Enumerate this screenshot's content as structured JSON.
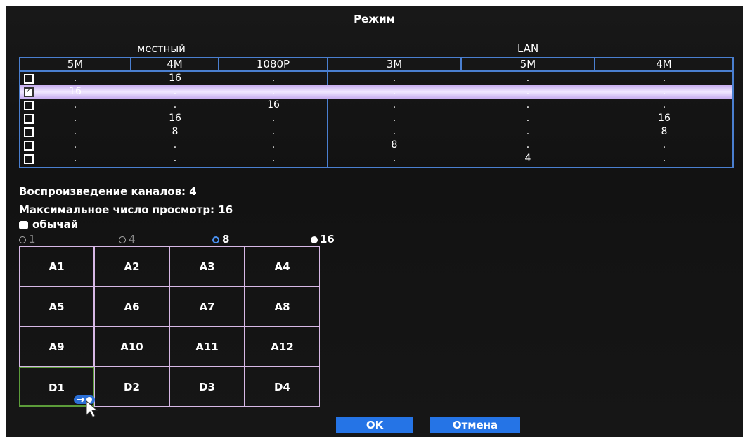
{
  "title": "Режим",
  "groups": {
    "local": "местный",
    "lan": "LAN"
  },
  "columns": [
    "5M",
    "4M",
    "1080P",
    "3M",
    "5M",
    "4M"
  ],
  "rows": [
    {
      "checked": false,
      "cells": [
        ".",
        "16",
        ".",
        ".",
        ".",
        "."
      ]
    },
    {
      "checked": true,
      "cells": [
        "16",
        ".",
        ".",
        ".",
        ".",
        "."
      ]
    },
    {
      "checked": false,
      "cells": [
        ".",
        ".",
        "16",
        ".",
        ".",
        "."
      ]
    },
    {
      "checked": false,
      "cells": [
        ".",
        "16",
        ".",
        ".",
        ".",
        "16"
      ]
    },
    {
      "checked": false,
      "cells": [
        ".",
        "8",
        ".",
        ".",
        ".",
        "8"
      ]
    },
    {
      "checked": false,
      "cells": [
        ".",
        ".",
        ".",
        "8",
        ".",
        "."
      ]
    },
    {
      "checked": false,
      "cells": [
        ".",
        ".",
        ".",
        ".",
        "4",
        "."
      ]
    }
  ],
  "info": {
    "playback_channels": "Воспроизведение каналов: 4",
    "max_view": "Максимальное число просмотр: 16"
  },
  "normal_label": "обычай",
  "split_options": [
    {
      "label": "1",
      "selected": false
    },
    {
      "label": "4",
      "selected": false
    },
    {
      "label": "8",
      "selected": false
    },
    {
      "label": "16",
      "selected": true
    }
  ],
  "channel_grid": [
    [
      "A1",
      "A2",
      "A3",
      "A4"
    ],
    [
      "A5",
      "A6",
      "A7",
      "A8"
    ],
    [
      "A9",
      "A10",
      "A11",
      "A12"
    ],
    [
      "D1",
      "D2",
      "D3",
      "D4"
    ]
  ],
  "buttons": {
    "ok": "OK",
    "cancel": "Отмена"
  },
  "colors": {
    "accent": "#2574e6",
    "table_border": "#4a7fd0",
    "selected_row": "#e6d8ff"
  }
}
